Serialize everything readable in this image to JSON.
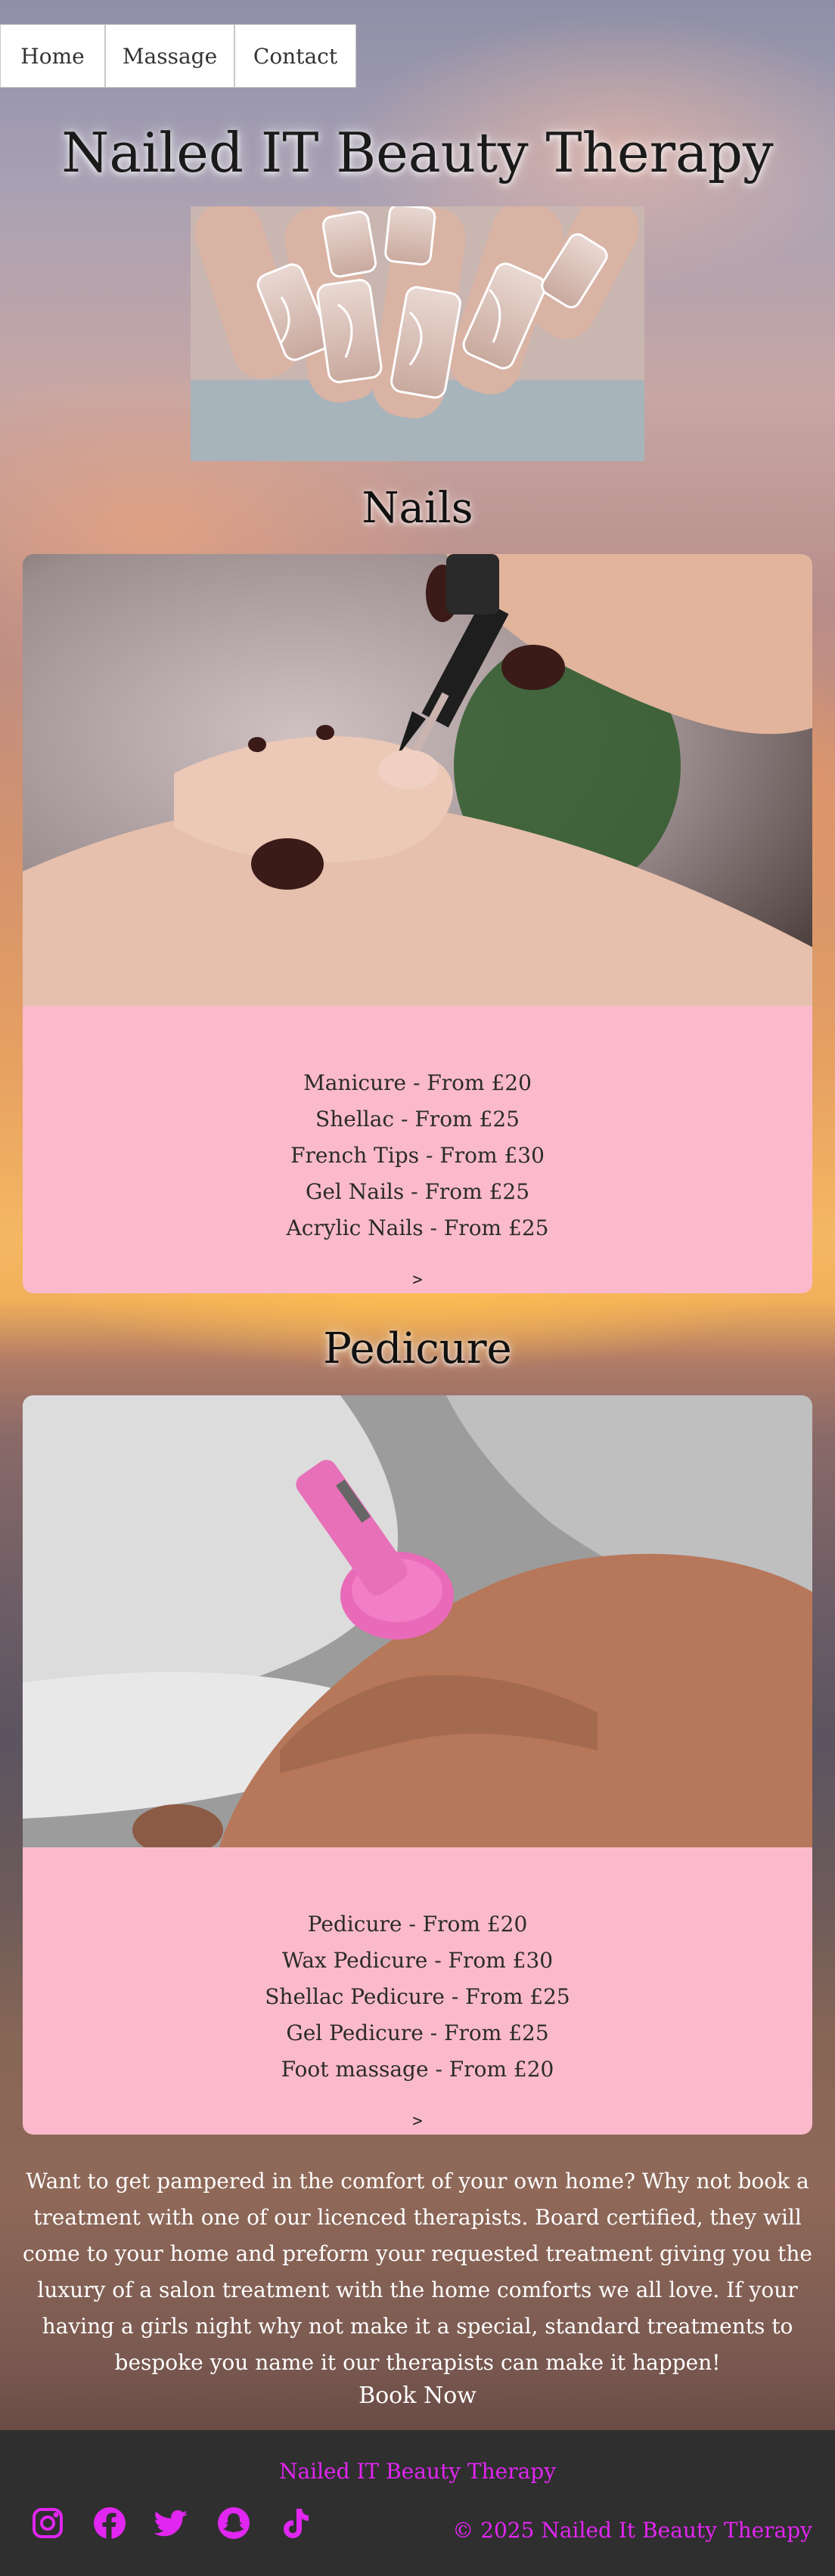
{
  "nav": {
    "items": [
      {
        "label": "Home"
      },
      {
        "label": "Massage"
      },
      {
        "label": "Contact"
      }
    ]
  },
  "site_title": "Nailed IT Beauty Therapy",
  "sections": [
    {
      "title": "Nails",
      "services": [
        "Manicure - From £20",
        "Shellac - From £25",
        "French Tips - From £30",
        "Gel Nails - From £25",
        "Acrylic Nails - From £25"
      ],
      "more_label": ">"
    },
    {
      "title": "Pedicure",
      "services": [
        "Pedicure - From £20",
        "Wax Pedicure - From £30",
        "Shellac Pedicure - From £25",
        "Gel Pedicure - From £25",
        "Foot massage - From £20"
      ],
      "more_label": ">"
    }
  ],
  "intro_text": "Want to get pampered in the comfort of your own home? Why not book a treatment with one of our licenced therapists. Board certified, they will come to your home and preform your requested treatment giving you the luxury of a salon treatment with the home comforts we all love. If your having a girls night why not make it a special, standard treatments to bespoke you name it our therapists can make it happen!",
  "book_label": "Book Now",
  "footer": {
    "brand": "Nailed IT Beauty Therapy",
    "copyright": "© 2025 Nailed It Beauty Therapy",
    "social_icons": [
      "instagram-icon",
      "facebook-icon",
      "twitter-icon",
      "snapchat-icon",
      "tiktok-icon"
    ],
    "accent_color": "#e026f0"
  },
  "colors": {
    "card_background": "#fbbacb",
    "footer_background": "#2f2f2f"
  }
}
